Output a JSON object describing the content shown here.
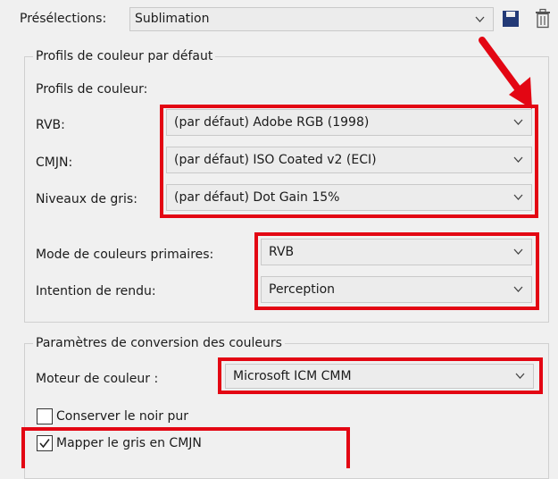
{
  "presets": {
    "label": "Présélections:",
    "value": "Sublimation"
  },
  "profiles_group": {
    "title": "Profils de couleur par défaut",
    "subtitle": "Profils de couleur:",
    "rows": [
      {
        "label": "RVB:",
        "value": "(par défaut) Adobe RGB (1998)"
      },
      {
        "label": "CMJN:",
        "value": "(par défaut) ISO Coated v2 (ECI)"
      },
      {
        "label": "Niveaux de gris:",
        "value": "(par défaut) Dot Gain 15%"
      }
    ],
    "primary_mode": {
      "label": "Mode de couleurs primaires:",
      "value": "RVB"
    },
    "rendering_intent": {
      "label": "Intention de rendu:",
      "value": "Perception"
    }
  },
  "conversion_group": {
    "title": "Paramètres de conversion des couleurs",
    "engine": {
      "label": "Moteur de couleur :",
      "value": "Microsoft ICM CMM"
    },
    "keep_black": {
      "label": "Conserver le noir pur",
      "checked": false
    },
    "map_gray": {
      "label": "Mapper le gris en CMJN",
      "checked": true
    }
  },
  "icons": [
    "chevron-down-icon",
    "save-icon",
    "delete-icon",
    "arrow-annotation"
  ],
  "colors": {
    "annotation": "#e30613",
    "background": "#f0f0f0",
    "field": "#ececec"
  }
}
